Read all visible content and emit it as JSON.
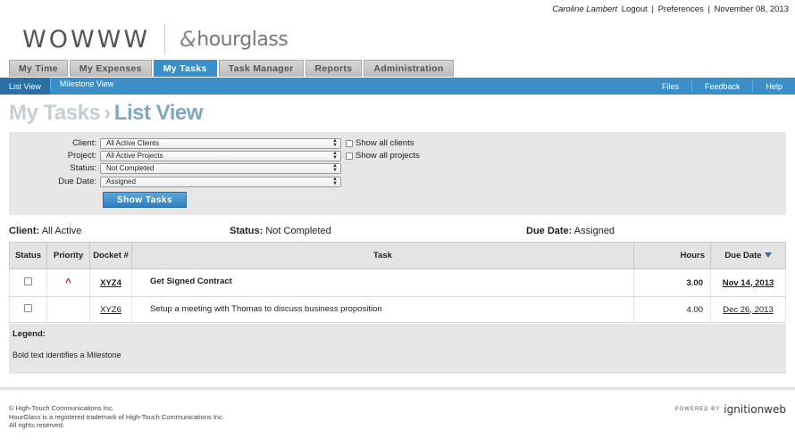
{
  "topbar": {
    "user": "Caroline Lambert",
    "logout": "Logout",
    "preferences": "Preferences",
    "date": "November 08, 2013",
    "separator": "|"
  },
  "logo": {
    "wowww": "WOWWW",
    "hourglass": "hourglass",
    "hourglass_mark": "&"
  },
  "tabs": [
    {
      "label": "My Time"
    },
    {
      "label": "My Expenses"
    },
    {
      "label": "My Tasks"
    },
    {
      "label": "Task Manager"
    },
    {
      "label": "Reports"
    },
    {
      "label": "Administration"
    }
  ],
  "subnav": {
    "left": [
      "List View",
      "Milestone View"
    ],
    "right": [
      "Files",
      "Feedback",
      "Help"
    ]
  },
  "page_title": {
    "section": "My Tasks",
    "separator": "›",
    "view": "List View"
  },
  "filters": {
    "client_label": "Client:",
    "client_value": "All Active Clients",
    "project_label": "Project:",
    "project_value": "All Active Projects",
    "status_label": "Status:",
    "status_value": "Not Completed",
    "due_label": "Due Date:",
    "due_value": "Assigned",
    "show_all_clients": "Show all clients",
    "show_all_projects": "Show all projects",
    "show_tasks_button": "Show Tasks"
  },
  "summary": {
    "client_label": "Client:",
    "client_value": "All Active",
    "status_label": "Status:",
    "status_value": "Not Completed",
    "due_label": "Due Date:",
    "due_value": "Assigned"
  },
  "table": {
    "headers": {
      "status": "Status",
      "priority": "Priority",
      "docket": "Docket #",
      "task": "Task",
      "hours": "Hours",
      "due": "Due Date"
    },
    "rows": [
      {
        "docket": "XYZ4",
        "task": "Get Signed Contract",
        "hours": "3.00",
        "due": "Nov 14, 2013",
        "priority": "^"
      },
      {
        "docket": "XYZ6",
        "task": "Setup a meeting with Thomas to discuss business proposition",
        "hours": "4.00",
        "due": "Dec 26, 2013"
      }
    ]
  },
  "legend": {
    "title": "Legend:",
    "desc": "Bold text identifies a Milestone"
  },
  "footer": {
    "line1": "© High-Touch Communications Inc.",
    "line2": "HourGlass is a registered trademark of High-Touch Communications Inc.",
    "line3": "All rights reserved.",
    "powered_by": "POWERED BY",
    "brand": "ignitionweb"
  }
}
